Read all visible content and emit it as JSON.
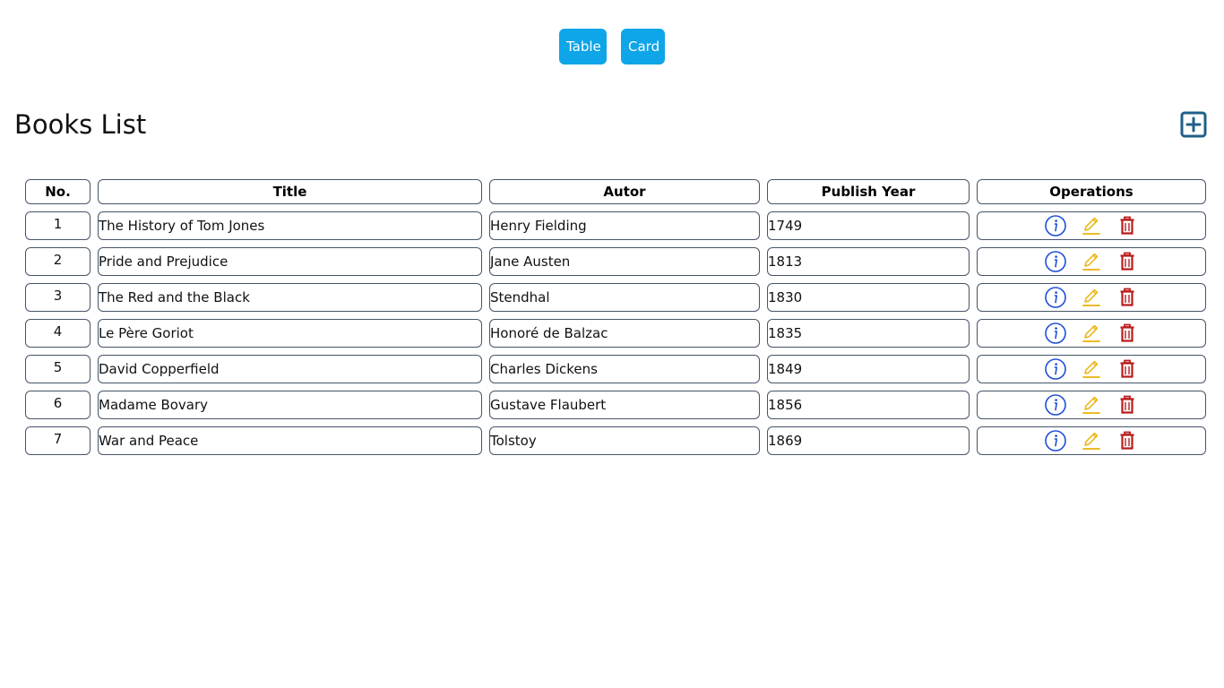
{
  "view_toggle": {
    "table_label": "Table",
    "card_label": "Card"
  },
  "page": {
    "title": "Books List",
    "add_icon": "plus-square-icon"
  },
  "table": {
    "headers": {
      "no": "No.",
      "title": "Title",
      "autor": "Autor",
      "year": "Publish Year",
      "operations": "Operations"
    },
    "rows": [
      {
        "no": "1",
        "title": "The History of Tom Jones",
        "autor": "Henry Fielding",
        "year": "1749"
      },
      {
        "no": "2",
        "title": "Pride and Prejudice",
        "autor": "Jane Austen",
        "year": "1813"
      },
      {
        "no": "3",
        "title": "The Red and the Black",
        "autor": "Stendhal",
        "year": "1830"
      },
      {
        "no": "4",
        "title": "Le Père Goriot",
        "autor": "Honoré de Balzac",
        "year": "1835"
      },
      {
        "no": "5",
        "title": "David Copperfield",
        "autor": "Charles Dickens",
        "year": "1849"
      },
      {
        "no": "6",
        "title": "Madame Bovary",
        "autor": "Gustave Flaubert",
        "year": "1856"
      },
      {
        "no": "7",
        "title": "War and Peace",
        "autor": "Tolstoy",
        "year": "1869"
      }
    ]
  },
  "operation_icons": {
    "info": "info-circle-icon",
    "edit": "pencil-icon",
    "delete": "trash-icon"
  },
  "colors": {
    "toggle_button": "#0ea5e9",
    "add_icon": "#1f5f87",
    "info_icon": "#1d4ed8",
    "edit_icon": "#eab308",
    "delete_icon": "#b91c1c",
    "cell_border": "#475569"
  }
}
